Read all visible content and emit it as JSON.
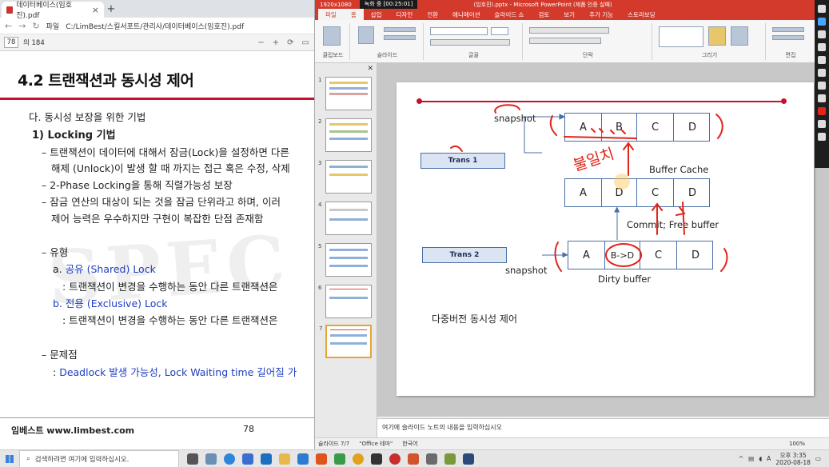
{
  "pdf": {
    "tab_title": "데이터베이스(임호진).pdf",
    "address_label": "파일",
    "address": "C:/LimBest/스킬서포트/관리사/데이터베이스(임호진).pdf",
    "page_current": "78",
    "page_total": "의 184",
    "heading": "4.2 트랜잭션과 동시성 제어",
    "lines": {
      "l1": "다. 동시성 보장을 위한 기법",
      "l2": "1) Locking 기법",
      "l3": "– 트랜잭션이 데이터에 대해서 잠금(Lock)을 설정하면 다른",
      "l4": "해제 (Unlock)이 발생 할 때 까지는 접근 혹은 수정, 삭제",
      "l5": "– 2-Phase Locking을 통해 직렬가능성 보장",
      "l6": "– 잠금 연산의 대상이 되는 것을 잠금 단위라고 하며, 이러",
      "l7": "제어 능력은 우수하지만 구현이 복잡한 단점 존재함",
      "l8": "– 유형",
      "l9_pre": "a. ",
      "l9_blue": "공유 (Shared) Lock",
      "l10": ": 트랜잭션이 변경을 수행하는 동안 다른 트랜잭션은 ",
      "l11_blue": "b. 전용 (Exclusive) Lock",
      "l12": ": 트랜잭션이 변경을 수행하는 동안 다른 트랜잭션은 ",
      "l13": "– 문제점",
      "l14_pre": ": ",
      "l14_blue": "Deadlock 발생 가능성, Lock Waiting time 길어질 가"
    },
    "footer_brand": "임베스트 www.limbest.com",
    "footer_page": "78"
  },
  "ppt": {
    "recording": "녹화 중 [00:25:01]",
    "resolution": "1920x1080",
    "title": "(임호진).pptx - Microsoft PowerPoint (제품 인증 실패)",
    "tabs": [
      "파일",
      "홈",
      "삽입",
      "디자인",
      "전환",
      "애니메이션",
      "슬라이드 쇼",
      "검토",
      "보기",
      "추가 기능",
      "스토리보딩"
    ],
    "ribbon_groups": [
      "클립보드",
      "슬라이드",
      "글꼴",
      "단락",
      "그리기",
      "편집"
    ],
    "notes_placeholder": "여기에 슬라이드 노트의 내용을 입력하십시오",
    "status_slide": "슬라이드 7/7",
    "status_theme": "\"Office 테마\"",
    "status_lang": "한국어",
    "zoom": "100%",
    "slide": {
      "trans1": "Trans 1",
      "trans2": "Trans 2",
      "snapshot_top": "snapshot",
      "snapshot_bottom": "snapshot",
      "row1": [
        "A",
        "B",
        "C",
        "D"
      ],
      "row2": [
        "A",
        "D",
        "C",
        "D"
      ],
      "row3": [
        "A",
        "B->D",
        "C",
        "D"
      ],
      "buffer_cache": "Buffer Cache",
      "commit_free": "Commit;  Free buffer",
      "dirty": "Dirty buffer",
      "caption": "다중버전 동시성 제어",
      "handwriting": "불일치"
    },
    "thumb_numbers": [
      "1",
      "2",
      "3",
      "4",
      "5",
      "6",
      "7"
    ]
  },
  "taskbar": {
    "search_placeholder": "검색하려면 여기에 입력하십시오.",
    "time": "오후 3:35",
    "date": "2020-08-18"
  }
}
